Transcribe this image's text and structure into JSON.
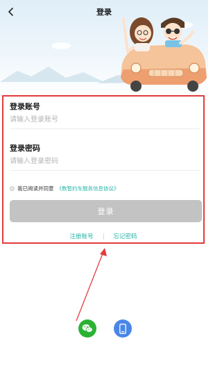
{
  "header": {
    "title": "登录"
  },
  "form": {
    "account_label": "登录账号",
    "account_placeholder": "请输入登录账号",
    "password_label": "登录密码",
    "password_placeholder": "请输入登录密码",
    "agree_text": "我已阅读并同意",
    "agreement_link": "《数智约车服务信息协议》",
    "agreed": false,
    "login_button": "登录",
    "register_link": "注册账号",
    "forgot_link": "忘记密码"
  },
  "third_party_login": [
    {
      "name": "wechat",
      "icon": "wechat-icon",
      "color": "#2bb233"
    },
    {
      "name": "phone",
      "icon": "phone-icon",
      "color": "#4a86e8"
    }
  ],
  "colors": {
    "accent": "#2ab3a8",
    "highlight_border": "#e23b3b",
    "login_button_bg": "#c3c3c3",
    "annotation_arrow": "#e23b3b"
  }
}
